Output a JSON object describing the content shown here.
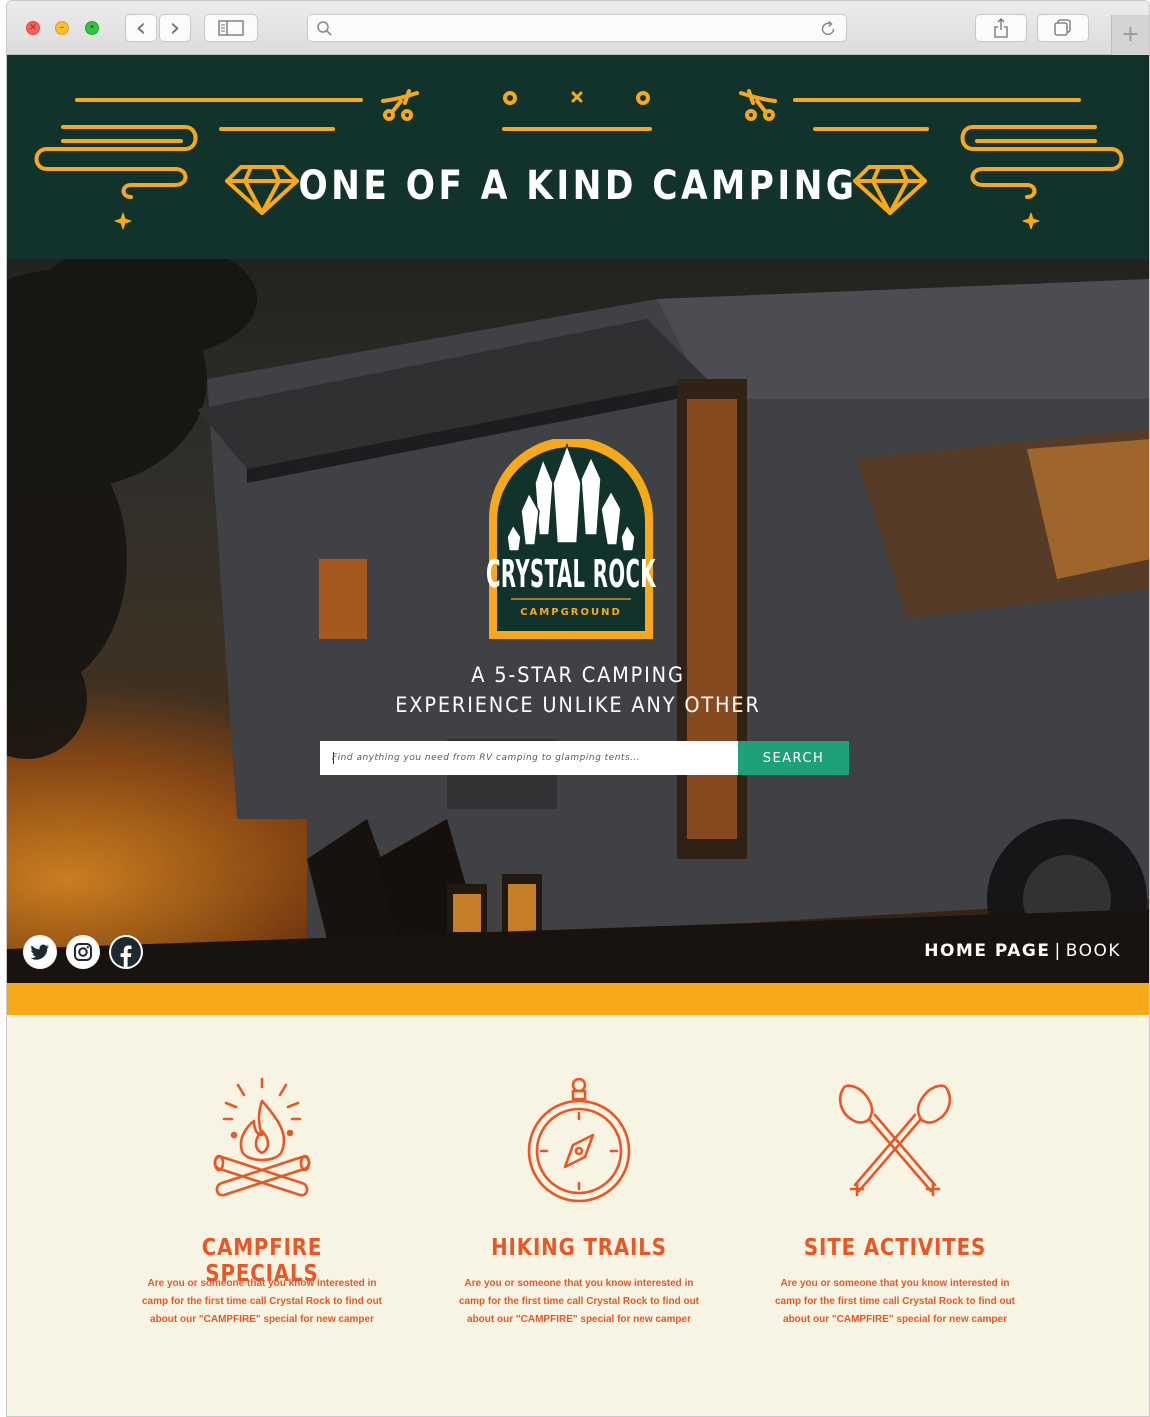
{
  "browser": {
    "back_label": "‹",
    "forward_label": "›",
    "new_tab_label": "+"
  },
  "banner": {
    "title": "ONE OF A KIND CAMPING"
  },
  "hero": {
    "logo": {
      "name": "CRYSTAL ROCK",
      "subtitle": "CAMPGROUND"
    },
    "tagline_line1": "A 5-STAR CAMPING",
    "tagline_line2": "EXPERIENCE UNLIKE ANY OTHER",
    "search": {
      "placeholder": "Find anything you need from RV camping to glamping tents...",
      "button_label": "SEARCH"
    },
    "social": [
      "twitter-icon",
      "instagram-icon",
      "facebook-icon"
    ],
    "nav": {
      "home_label": "HOME PAGE",
      "separator": "|",
      "book_label": "BOOK"
    }
  },
  "features": [
    {
      "icon": "campfire-icon",
      "title": "CAMPFIRE SPECIALS",
      "text": "Are you  or someone that you know interested in camp for the first time call Crystal Rock to find out about our \"CAMPFIRE\" special for new camper"
    },
    {
      "icon": "compass-icon",
      "title": "HIKING TRAILS",
      "text": "Are you  or someone that you know interested in camp for the first time call Crystal Rock to find out about our \"CAMPFIRE\" special for new camper"
    },
    {
      "icon": "paddles-icon",
      "title": "SITE ACTIVITES",
      "text": "Are you  or someone that you know interested in camp for the first time call Crystal Rock to find out about our \"CAMPFIRE\" special for new camper"
    }
  ],
  "colors": {
    "banner_bg": "#12332c",
    "accent_orange": "#f8a91a",
    "feature_red": "#ea5626",
    "search_green": "#1ea07a",
    "cream": "#f7f4e3"
  }
}
